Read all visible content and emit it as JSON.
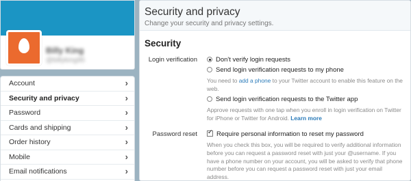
{
  "profile": {
    "name": "Billy King",
    "handle": "@billyking95"
  },
  "nav": {
    "items": [
      {
        "label": "Account"
      },
      {
        "label": "Security and privacy",
        "active": true
      },
      {
        "label": "Password"
      },
      {
        "label": "Cards and shipping"
      },
      {
        "label": "Order history"
      },
      {
        "label": "Mobile"
      },
      {
        "label": "Email notifications"
      }
    ],
    "chevron": "›"
  },
  "header": {
    "title": "Security and privacy",
    "subtitle": "Change your security and privacy settings."
  },
  "security": {
    "title": "Security",
    "login_verification": {
      "label": "Login verification",
      "options": [
        {
          "label": "Don't verify login requests",
          "selected": true
        },
        {
          "label": "Send login verification requests to my phone",
          "selected": false
        },
        {
          "label": "Send login verification requests to the Twitter app",
          "selected": false
        }
      ],
      "phone_help_pre": "You need to ",
      "phone_help_link": "add a phone",
      "phone_help_post": " to your Twitter account to enable this feature on the web.",
      "app_help_pre": "Approve requests with one tap when you enroll in login verification on Twitter for iPhone or Twitter for Android. ",
      "app_help_link": "Learn more"
    },
    "password_reset": {
      "label": "Password reset",
      "checkbox_label": "Require personal information to reset my password",
      "checked": true,
      "help": "When you check this box, you will be required to verify additional information before you can request a password reset with just your @username. If you have a phone number on your account, you will be asked to verify that phone number before you can request a password reset with just your email address."
    }
  },
  "colors": {
    "background": "#9cb3c1",
    "banner": "#1b95c4",
    "avatar": "#eb6a2e",
    "link": "#2b7bb9"
  }
}
